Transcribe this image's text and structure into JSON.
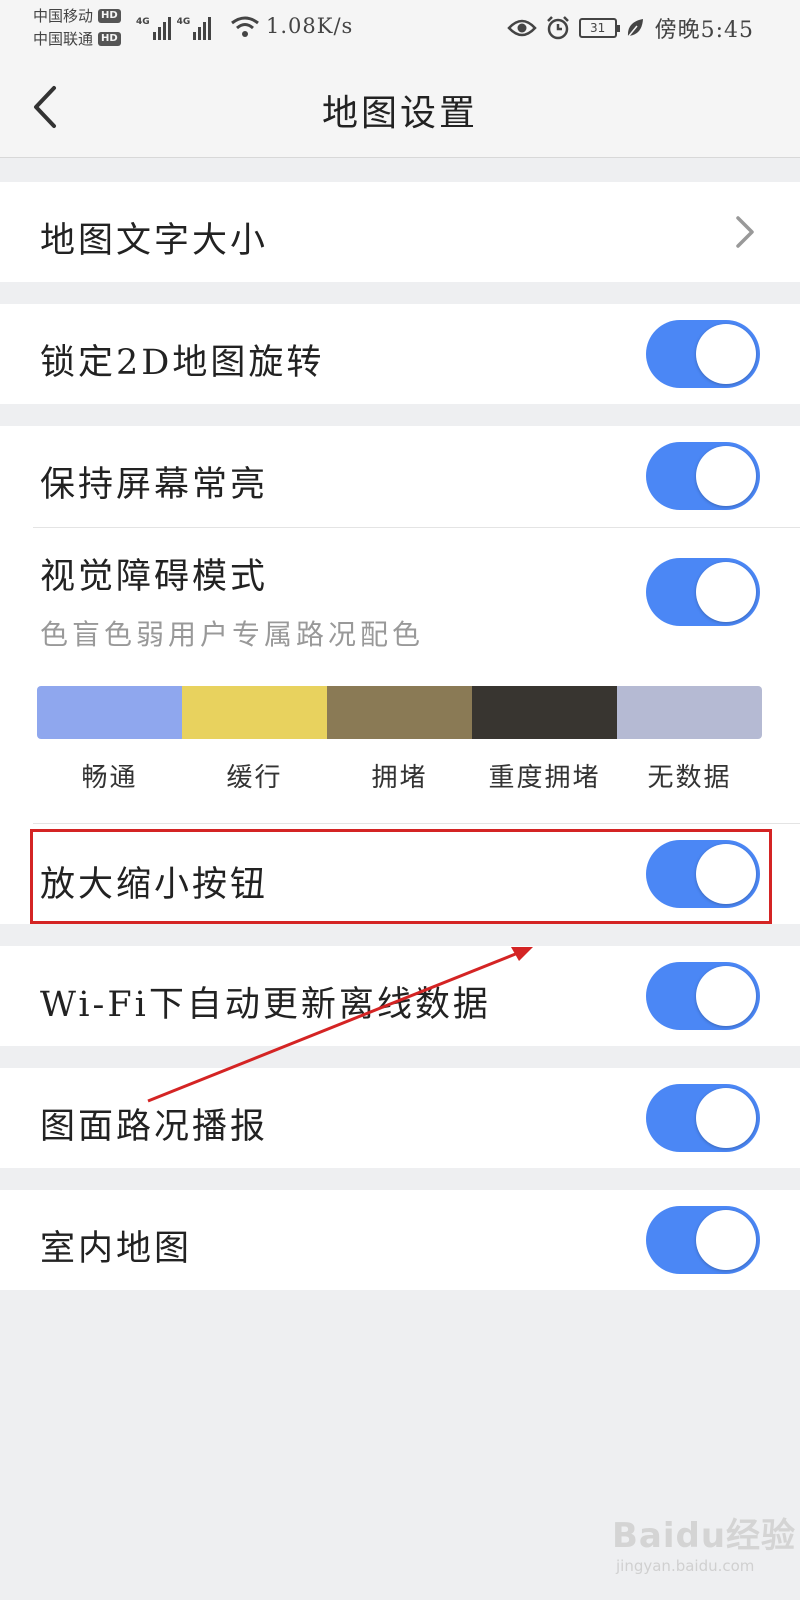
{
  "status_bar": {
    "carriers": [
      {
        "name": "中国移动",
        "badge": "HD"
      },
      {
        "name": "中国联通",
        "badge": "HD"
      }
    ],
    "signal_labels": [
      "4G",
      "4G"
    ],
    "net_speed": "1.08K/s",
    "battery": "31",
    "time": "傍晚5:45",
    "icons": [
      "eye-icon",
      "alarm-icon",
      "battery-icon",
      "leaf-icon",
      "wifi-icon",
      "signal-icon"
    ]
  },
  "header": {
    "title": "地图设置",
    "back_icon": "chevron-left-icon"
  },
  "settings": {
    "font_size": {
      "label": "地图文字大小"
    },
    "lock_2d_rotation": {
      "label": "锁定2D地图旋转",
      "enabled": true
    },
    "keep_screen_on": {
      "label": "保持屏幕常亮",
      "enabled": true
    },
    "color_blind_mode": {
      "label": "视觉障碍模式",
      "subtitle": "色盲色弱用户专属路况配色",
      "enabled": true,
      "legend": [
        {
          "label": "畅通",
          "color": "#8fa7ee"
        },
        {
          "label": "缓行",
          "color": "#e8d25e"
        },
        {
          "label": "拥堵",
          "color": "#8a7a55"
        },
        {
          "label": "重度拥堵",
          "color": "#383530"
        },
        {
          "label": "无数据",
          "color": "#b5bad3"
        }
      ]
    },
    "zoom_buttons": {
      "label": "放大缩小按钮",
      "enabled": true
    },
    "wifi_auto_update": {
      "label": "Wi-Fi下自动更新离线数据",
      "enabled": true
    },
    "traffic_broadcast": {
      "label": "图面路况播报",
      "enabled": true
    },
    "indoor_map": {
      "label": "室内地图",
      "enabled": true
    }
  },
  "colors": {
    "toggle_on": "#4b87f5",
    "annotation": "#d42424",
    "background": "#eeeff1"
  },
  "watermark": {
    "logo": "Baidu经验",
    "url": "jingyan.baidu.com"
  }
}
